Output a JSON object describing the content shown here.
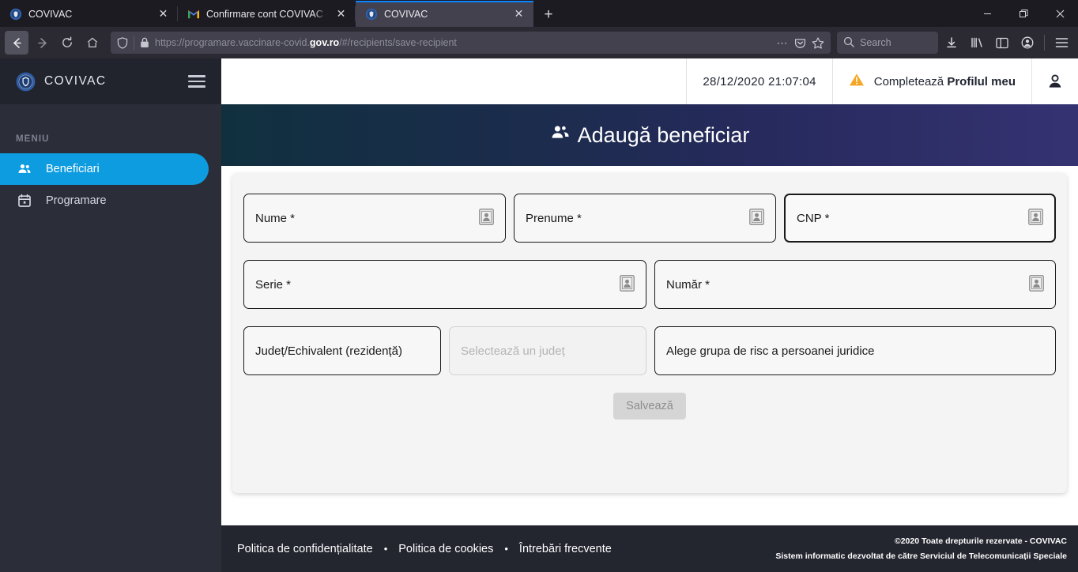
{
  "browser": {
    "tabs": [
      {
        "title": "COVIVAC",
        "favicon": "covivac-icon",
        "active": false
      },
      {
        "title": "Confirmare cont COVIVAC - cla",
        "favicon": "gmail-icon",
        "active": false
      },
      {
        "title": "COVIVAC",
        "favicon": "covivac-icon",
        "active": true
      }
    ],
    "new_tab_label": "+",
    "close_label": "✕",
    "window_controls": {
      "minimize": "—",
      "restore": "❐",
      "close": "✕"
    },
    "nav": {
      "back": "back-arrow",
      "forward": "forward-arrow",
      "reload": "reload-icon",
      "home": "home-icon"
    },
    "url": {
      "prefix": "https://programare.vaccinare-covid.",
      "domain": "gov.ro",
      "suffix": "/#/recipients/save-recipient"
    },
    "search_placeholder": "Search",
    "toolbar_icons": [
      "downloads-icon",
      "library-icon",
      "sidebar-icon",
      "account-icon",
      "app-menu-icon"
    ]
  },
  "sidebar": {
    "brand": "COVIVAC",
    "menu_label": "MENIU",
    "items": [
      {
        "label": "Beneficiari",
        "icon": "people-icon",
        "active": true
      },
      {
        "label": "Programare",
        "icon": "calendar-icon",
        "active": false
      }
    ],
    "accent_color": "#0d9ce0",
    "background_color": "#2b2d38"
  },
  "topbar": {
    "datetime": "28/12/2020 21:07:04",
    "profile_prompt_prefix": "Completează ",
    "profile_prompt_strong": "Profilul meu",
    "warning_color": "#f5a623",
    "user_icon": "user-icon"
  },
  "page": {
    "title": "Adaugă beneficiar",
    "title_icon": "add-person-icon",
    "gradient_from": "#10303f",
    "gradient_to": "#353272"
  },
  "form": {
    "fields": [
      {
        "name": "nume",
        "label": "Nume *",
        "icon": "id-photo-icon",
        "focused": false,
        "disabled": false
      },
      {
        "name": "prenume",
        "label": "Prenume *",
        "icon": "id-photo-icon",
        "focused": false,
        "disabled": false
      },
      {
        "name": "cnp",
        "label": "CNP *",
        "icon": "id-photo-icon",
        "focused": true,
        "disabled": false
      },
      {
        "name": "serie",
        "label": "Serie *",
        "icon": "id-photo-icon",
        "focused": false,
        "disabled": false
      },
      {
        "name": "numar",
        "label": "Număr *",
        "icon": "id-photo-icon",
        "focused": false,
        "disabled": false
      },
      {
        "name": "judet-label",
        "label": "Județ/Echivalent (rezidență)",
        "icon": null,
        "focused": false,
        "disabled": false
      },
      {
        "name": "judet-select",
        "label": "Selectează un județ",
        "icon": null,
        "focused": false,
        "disabled": true
      },
      {
        "name": "grupa-risc",
        "label": "Alege grupa de risc a persoanei juridice",
        "icon": null,
        "focused": false,
        "disabled": false
      }
    ],
    "save_label": "Salvează"
  },
  "footer": {
    "links": [
      "Politica de confidențialitate",
      "Politica de cookies",
      "Întrebări frecvente"
    ],
    "separator": "•",
    "copyright": "©2020 Toate drepturile rezervate - COVIVAC",
    "developed_by": "Sistem informatic dezvoltat de către Serviciul de Telecomunicații Speciale"
  }
}
